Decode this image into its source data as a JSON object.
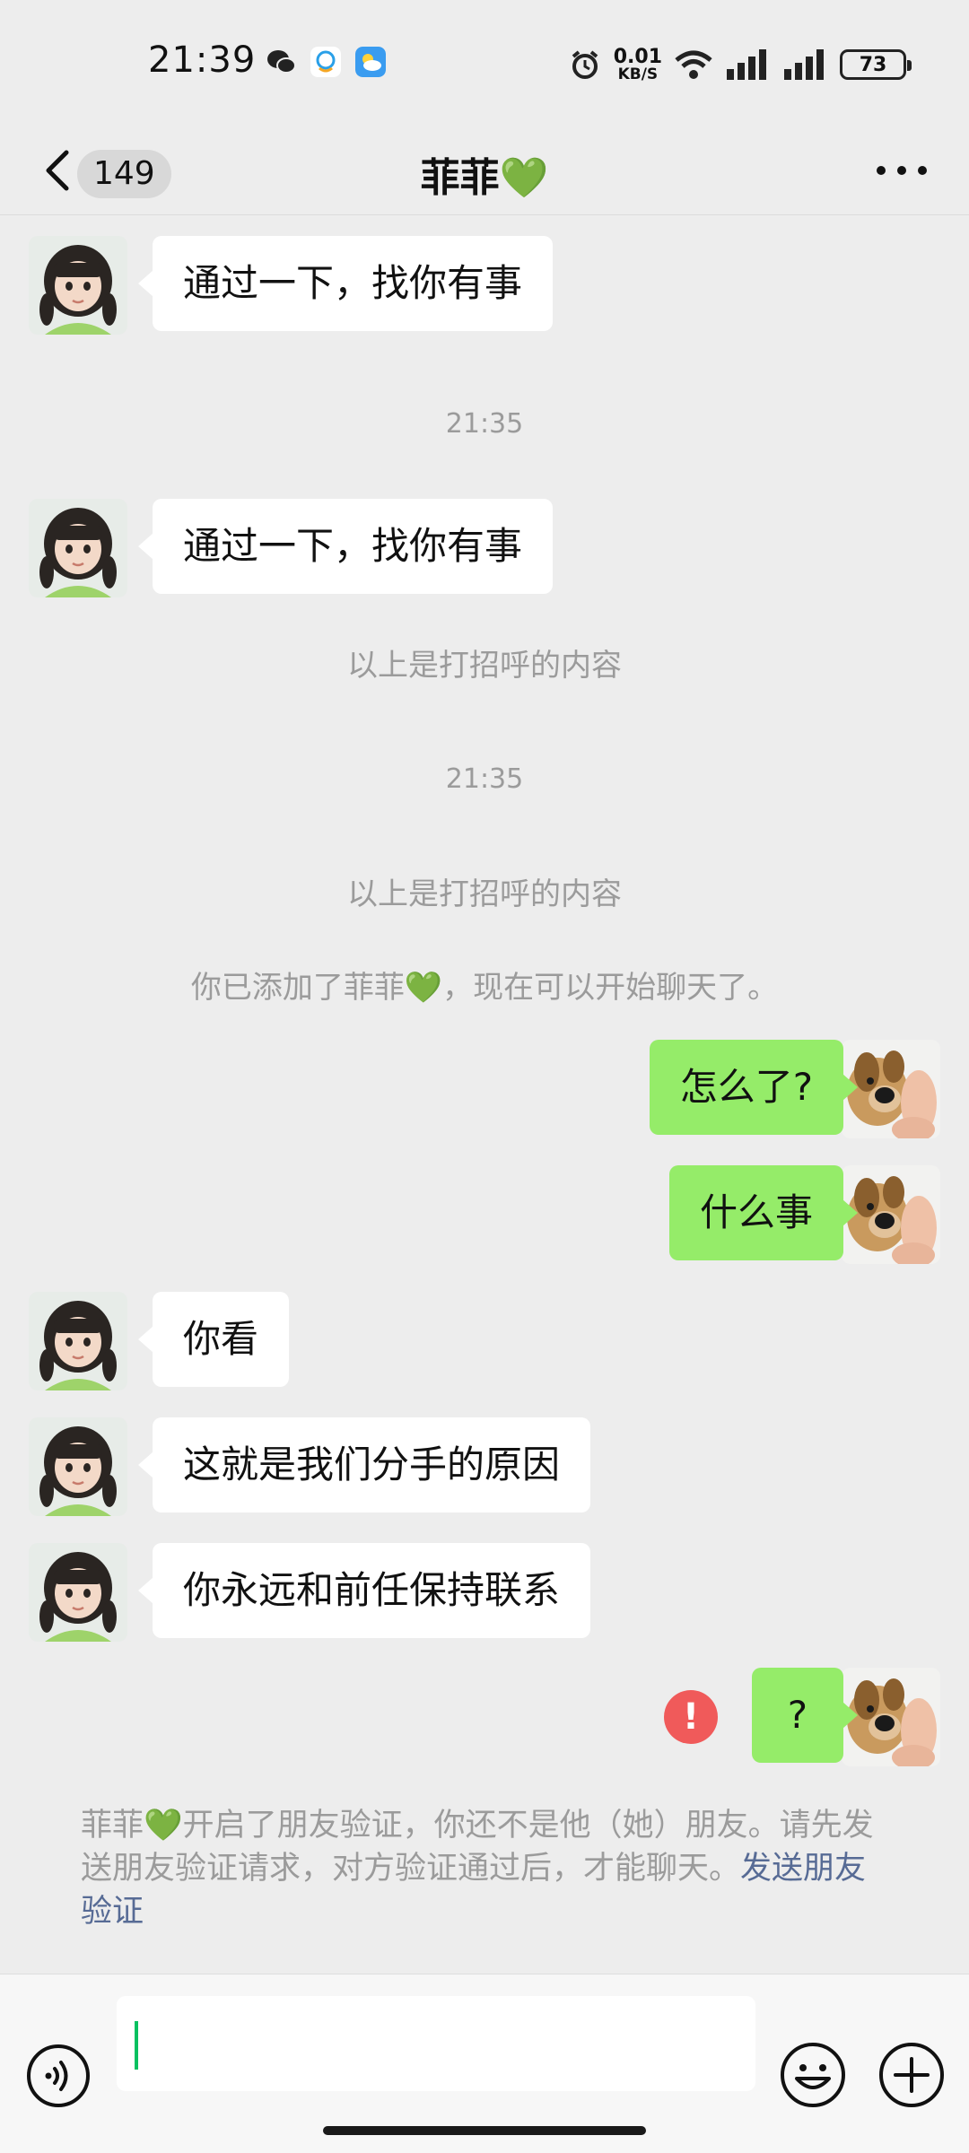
{
  "status_bar": {
    "time": "21:39",
    "net_speed_value": "0.01",
    "net_speed_unit": "KB/S",
    "battery": "73",
    "icons": [
      "wechat-icon",
      "qq-icon",
      "weather-icon",
      "alarm-icon",
      "wifi-icon",
      "signal-icon",
      "signal-icon",
      "battery-icon"
    ]
  },
  "nav": {
    "back_label": "back",
    "unread_count": "149",
    "title": "菲菲💚",
    "more_icon": "more-icon"
  },
  "colors": {
    "background": "#ededed",
    "outgoing_bubble": "#95ec69",
    "incoming_bubble": "#ffffff",
    "system_text": "#9b9b9b",
    "link": "#576b95",
    "error": "#f05a5a",
    "caret": "#07c160"
  },
  "messages": [
    {
      "side": "in",
      "text": "通过一下，找你有事"
    },
    {
      "type": "time",
      "text": "21:35"
    },
    {
      "side": "in",
      "text": "通过一下，找你有事"
    },
    {
      "type": "system",
      "text": "以上是打招呼的内容"
    },
    {
      "type": "time",
      "text": "21:35"
    },
    {
      "type": "system",
      "text": "以上是打招呼的内容"
    },
    {
      "type": "system",
      "text": "你已添加了菲菲💚，现在可以开始聊天了。"
    },
    {
      "side": "out",
      "text": "怎么了?"
    },
    {
      "side": "out",
      "text": "什么事"
    },
    {
      "side": "in",
      "text": "你看"
    },
    {
      "side": "in",
      "text": "这就是我们分手的原因"
    },
    {
      "side": "in",
      "text": "你永远和前任保持联系"
    },
    {
      "side": "out",
      "text": "?",
      "status": "failed",
      "status_mark": "!"
    }
  ],
  "notice": {
    "text": "菲菲💚开启了朋友验证，你还不是他（她）朋友。请先发送朋友验证请求，对方验证通过后，才能聊天。",
    "link": "发送朋友验证"
  },
  "input_bar": {
    "value": "",
    "voice_icon": "voice-icon",
    "emoji_icon": "emoji-icon",
    "plus_icon": "plus-icon"
  }
}
